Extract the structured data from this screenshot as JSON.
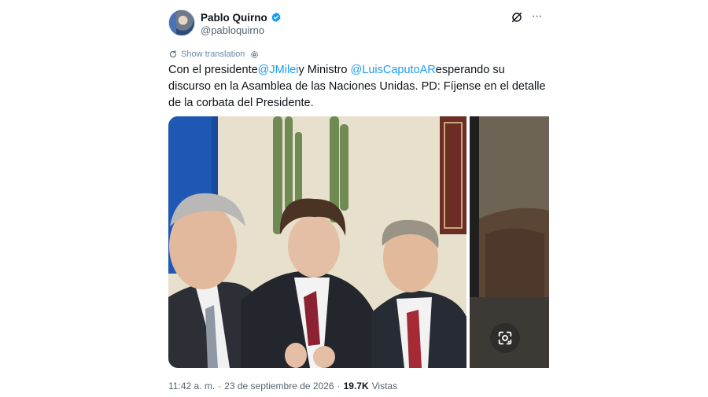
{
  "author": {
    "name": "Pablo Quirno",
    "handle": "@pabloquirno"
  },
  "icons": {
    "verified": "verified-badge-icon",
    "grok": "grok-icon",
    "more": "more-options-icon",
    "translate": "translate-icon",
    "settings": "gear-icon",
    "lens": "google-lens-icon"
  },
  "translation": {
    "label": "Show translation"
  },
  "tweet": {
    "text_1": "Con el presidente",
    "mention_1": "@JMilei",
    "text_2": "y Ministro",
    "mention_2": "@LuisCaputoAR",
    "text_3": "esperando su discurso en la Asamblea de las Naciones Unidas. PD: Fíjense en el detalle de la corbata del Presidente."
  },
  "meta": {
    "time": "11:42 a. m.",
    "separator_1": "·",
    "date": "23 de septiembre de 2026",
    "separator_2": "·",
    "views_count": "19.7K",
    "views_label": "Vistas"
  },
  "colors": {
    "mention": "#1d9bf0",
    "verified": "#1d9bf0",
    "secondary_text": "#536471"
  }
}
